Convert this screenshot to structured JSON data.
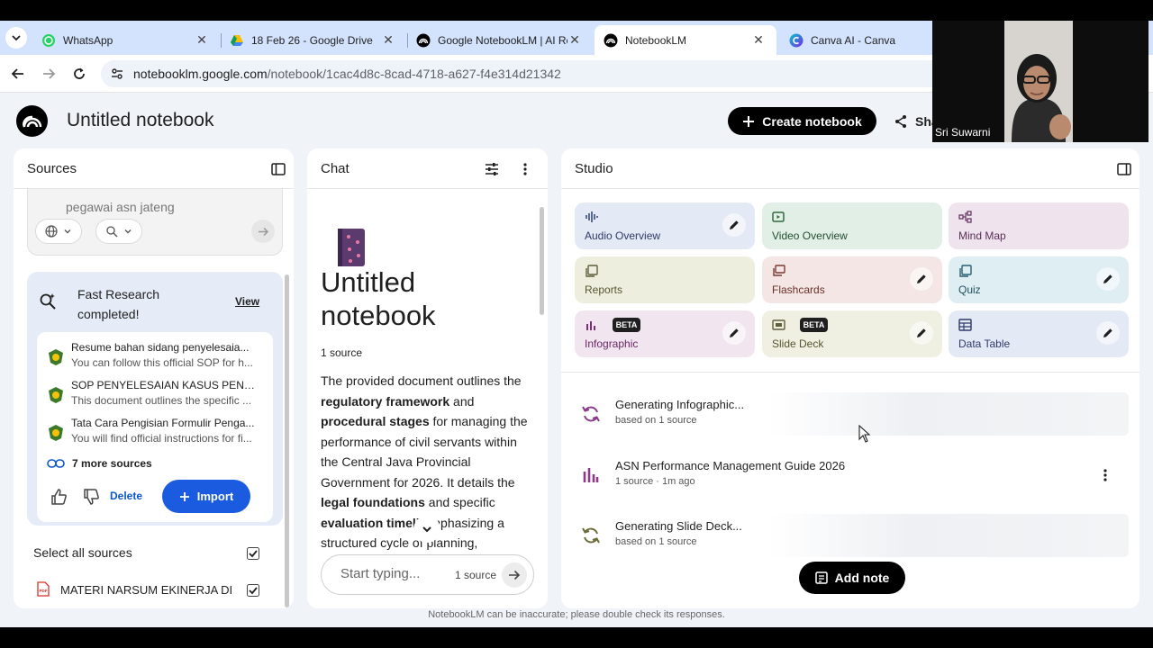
{
  "browser": {
    "tabs": [
      {
        "title": "WhatsApp",
        "icon": "whatsapp-icon",
        "active": false
      },
      {
        "title": "18 Feb 26 - Google Drive",
        "icon": "google-drive-icon",
        "active": false
      },
      {
        "title": "Google NotebookLM | AI Re",
        "icon": "notebooklm-icon",
        "active": false
      },
      {
        "title": "NotebookLM",
        "icon": "notebooklm-icon",
        "active": true
      },
      {
        "title": "Canva AI - Canva",
        "icon": "canva-icon",
        "active": false
      }
    ],
    "url_host": "notebooklm.google.com",
    "url_path": "/notebook/1cac4d8c-8cad-4718-a627-f4e314d21342"
  },
  "header": {
    "title": "Untitled notebook",
    "create_label": "Create notebook",
    "share_label": "Sha"
  },
  "sources": {
    "title": "Sources",
    "search_query": "pegawai asn jateng",
    "research": {
      "title": "Fast Research completed!",
      "view_label": "View",
      "items": [
        {
          "title": "Resume bahan sidang penyelesaia...",
          "desc": "You can follow this official SOP for h..."
        },
        {
          "title": "SOP PENYELESAIAN KASUS PENGA...",
          "desc": "This document outlines the specific ..."
        },
        {
          "title": "Tata Cara Pengisian Formulir Penga...",
          "desc": "You will find official instructions for fi..."
        }
      ],
      "more_label": "7 more sources",
      "delete_label": "Delete",
      "import_label": "Import"
    },
    "select_all_label": "Select all sources",
    "files": [
      {
        "name": "MATERI NARSUM EKINERJA DI ..."
      }
    ]
  },
  "chat": {
    "title": "Chat",
    "notebook_title": "Untitled notebook",
    "source_count": "1 source",
    "summary": {
      "p1": "The provided document outlines the ",
      "b1": "regulatory framework",
      "p2": " and ",
      "b2": "procedural stages",
      "p3": " for managing the performance of civil servants within the Central Java Provincial Government for 2026. It details the ",
      "b3": "legal foundations",
      "p4": " and specific ",
      "b4": "evaluation timeli",
      "p5": " emphasizing a structured cycle of planning,"
    },
    "input_placeholder": "Start typing...",
    "input_count": "1 source"
  },
  "studio": {
    "title": "Studio",
    "tiles": [
      {
        "label": "Audio Overview",
        "icon": "audio-waveform-icon",
        "beta": false
      },
      {
        "label": "Video Overview",
        "icon": "video-icon",
        "beta": false
      },
      {
        "label": "Mind Map",
        "icon": "mind-map-icon",
        "beta": false
      },
      {
        "label": "Reports",
        "icon": "reports-icon",
        "beta": false
      },
      {
        "label": "Flashcards",
        "icon": "flashcards-icon",
        "beta": false
      },
      {
        "label": "Quiz",
        "icon": "quiz-icon",
        "beta": false
      },
      {
        "label": "Infographic",
        "icon": "infographic-icon",
        "beta": true
      },
      {
        "label": "Slide Deck",
        "icon": "slide-deck-icon",
        "beta": true
      },
      {
        "label": "Data Table",
        "icon": "data-table-icon",
        "beta": false
      }
    ],
    "beta_label": "BETA",
    "outputs": [
      {
        "title": "Generating Infographic...",
        "sub": "based on 1 source"
      },
      {
        "title": "ASN Performance Management Guide 2026",
        "sub": "1 source · 1m ago"
      },
      {
        "title": "Generating Slide Deck...",
        "sub": "based on 1 source"
      }
    ],
    "add_note_label": "Add note"
  },
  "footer": {
    "disclaimer": "NotebookLM can be inaccurate; please double check its responses."
  },
  "webcam": {
    "name": "Sri Suwarni"
  }
}
